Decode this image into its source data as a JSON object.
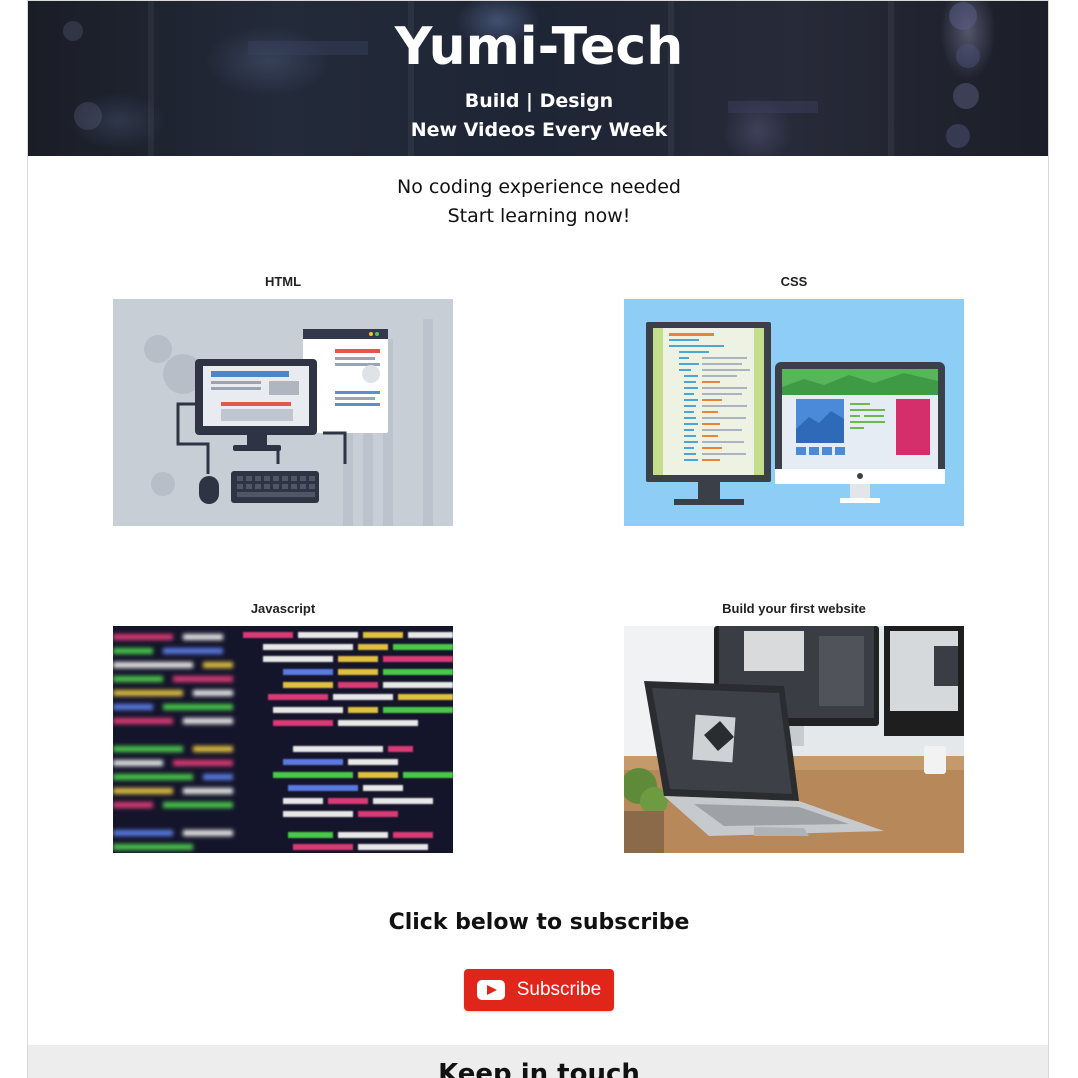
{
  "hero": {
    "title": "Yumi-Tech",
    "tagline": "Build | Design",
    "subtitle": "New Videos Every Week"
  },
  "intro": {
    "line1": "No coding experience needed",
    "line2": "Start learning now!"
  },
  "cards": [
    {
      "label": "HTML",
      "image": "computer-illustration"
    },
    {
      "label": "CSS",
      "image": "monitors-illustration"
    },
    {
      "label": "Javascript",
      "image": "code-screen-photo"
    },
    {
      "label": "Build your first website",
      "image": "laptop-desk-photo"
    }
  ],
  "subscribe": {
    "heading": "Click below to subscribe",
    "button_label": "Subscribe",
    "icon": "youtube-icon",
    "color": "#e0251b"
  },
  "footer": {
    "title": "Keep in touch"
  }
}
